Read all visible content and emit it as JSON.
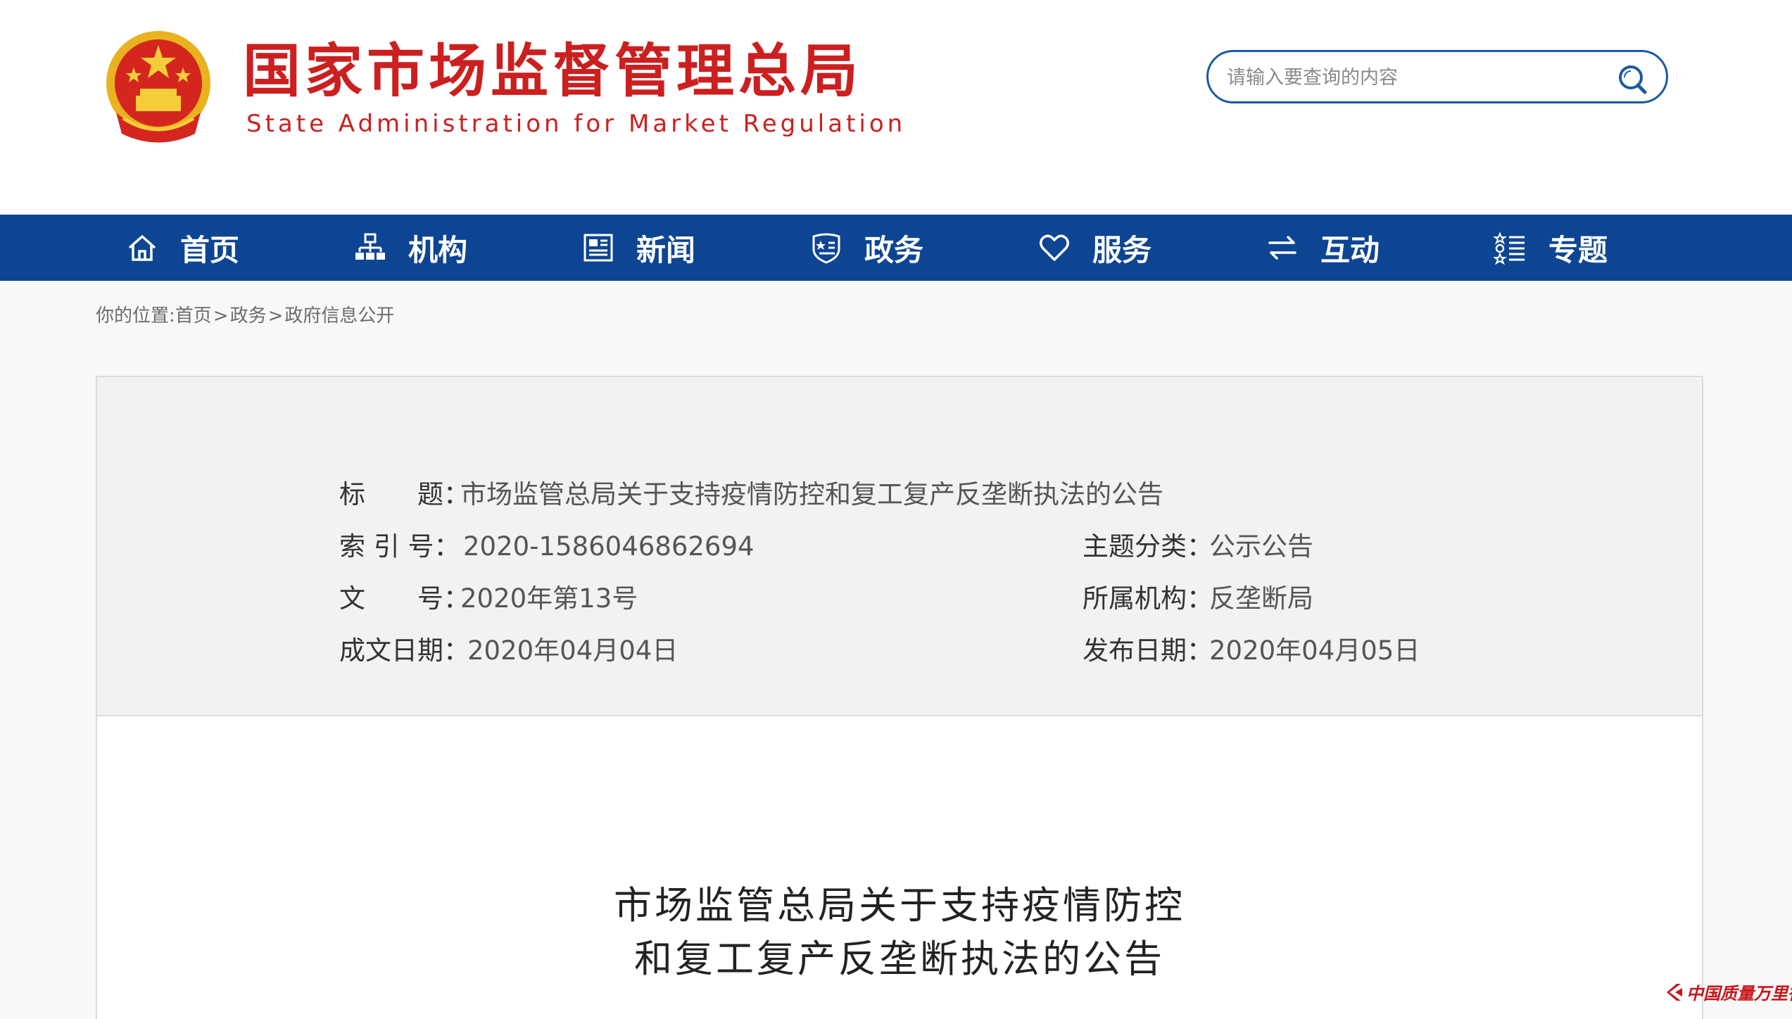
{
  "header": {
    "site_name_cn": "国家市场监督管理总局",
    "site_name_en": "State Administration for Market Regulation",
    "emblem": "national-emblem-icon",
    "search": {
      "placeholder": "请输入要查询的内容",
      "icon": "search-icon"
    }
  },
  "nav": {
    "items": [
      {
        "label": "首页",
        "icon": "home-icon"
      },
      {
        "label": "机构",
        "icon": "org-chart-icon"
      },
      {
        "label": "新闻",
        "icon": "newspaper-icon"
      },
      {
        "label": "政务",
        "icon": "shield-star-icon"
      },
      {
        "label": "服务",
        "icon": "heart-icon"
      },
      {
        "label": "互动",
        "icon": "exchange-arrows-icon"
      },
      {
        "label": "专题",
        "icon": "topic-list-icon"
      }
    ]
  },
  "breadcrumb": {
    "prefix": "你的位置:",
    "items": [
      "首页",
      "政务",
      "政府信息公开"
    ],
    "separator": ">"
  },
  "info": {
    "title_label": "标　　题：",
    "title_value": "市场监管总局关于支持疫情防控和复工复产反垄断执法的公告",
    "index_label": "索 引 号：",
    "index_value": "2020-1586046862694",
    "doc_no_label": "文　　号：",
    "doc_no_value": "2020年第13号",
    "written_date_label": "成文日期：",
    "written_date_value": "2020年04月04日",
    "topic_label": "主题分类：",
    "topic_value": "公示公告",
    "org_label": "所属机构：",
    "org_value": "反垄断局",
    "publish_date_label": "发布日期：",
    "publish_date_value": "2020年04月05日"
  },
  "article": {
    "title_line1": "市场监管总局关于支持疫情防控",
    "title_line2": "和复工复产反垄断执法的公告"
  },
  "watermark": {
    "text": "中国质量万里行"
  },
  "colors": {
    "brand_red": "#cc1f1f",
    "nav_blue": "#0d4593",
    "search_border": "#1a5aa3",
    "panel_bg": "#f2f2f2"
  }
}
